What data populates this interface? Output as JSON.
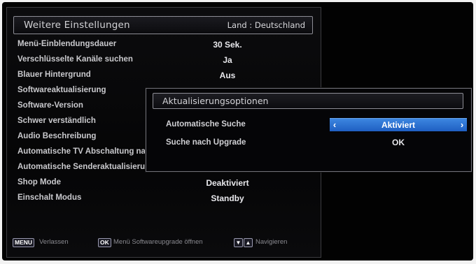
{
  "panel": {
    "title": "Weitere Einstellungen",
    "country": "Land : Deutschland",
    "items": [
      {
        "label": "Menü-Einblendungsdauer",
        "value": "30 Sek."
      },
      {
        "label": "Verschlüsselte Kanäle suchen",
        "value": "Ja"
      },
      {
        "label": "Blauer Hintergrund",
        "value": "Aus"
      },
      {
        "label": "Softwareaktualisierung",
        "value": ""
      },
      {
        "label": "Software-Version",
        "value": ""
      },
      {
        "label": "Schwer verständlich",
        "value": ""
      },
      {
        "label": "Audio Beschreibung",
        "value": ""
      },
      {
        "label": "Automatische TV Abschaltung nac",
        "value": ""
      },
      {
        "label": "Automatische Senderaktualisierun",
        "value": ""
      },
      {
        "label": "Shop Mode",
        "value": "Deaktiviert"
      },
      {
        "label": "Einschalt Modus",
        "value": "Standby"
      }
    ]
  },
  "popup": {
    "title": "Aktualisierungsoptionen",
    "rows": [
      {
        "label": "Automatische Suche",
        "value": "Aktiviert",
        "selected": true
      },
      {
        "label": "Suche nach Upgrade",
        "value": "OK",
        "selected": false
      }
    ]
  },
  "footer": {
    "menu_key": "MENU",
    "menu_text": "Verlassen",
    "ok_key": "OK",
    "ok_text": "Menü Softwareupgrade öffnen",
    "nav_text": "Navigieren"
  },
  "colors": {
    "highlight": "#2a6cd0",
    "panel_bg": "#060607"
  },
  "icons": {
    "left": "chevron-left-icon",
    "right": "chevron-right-icon",
    "nav": "arrow-up-down-icon"
  }
}
